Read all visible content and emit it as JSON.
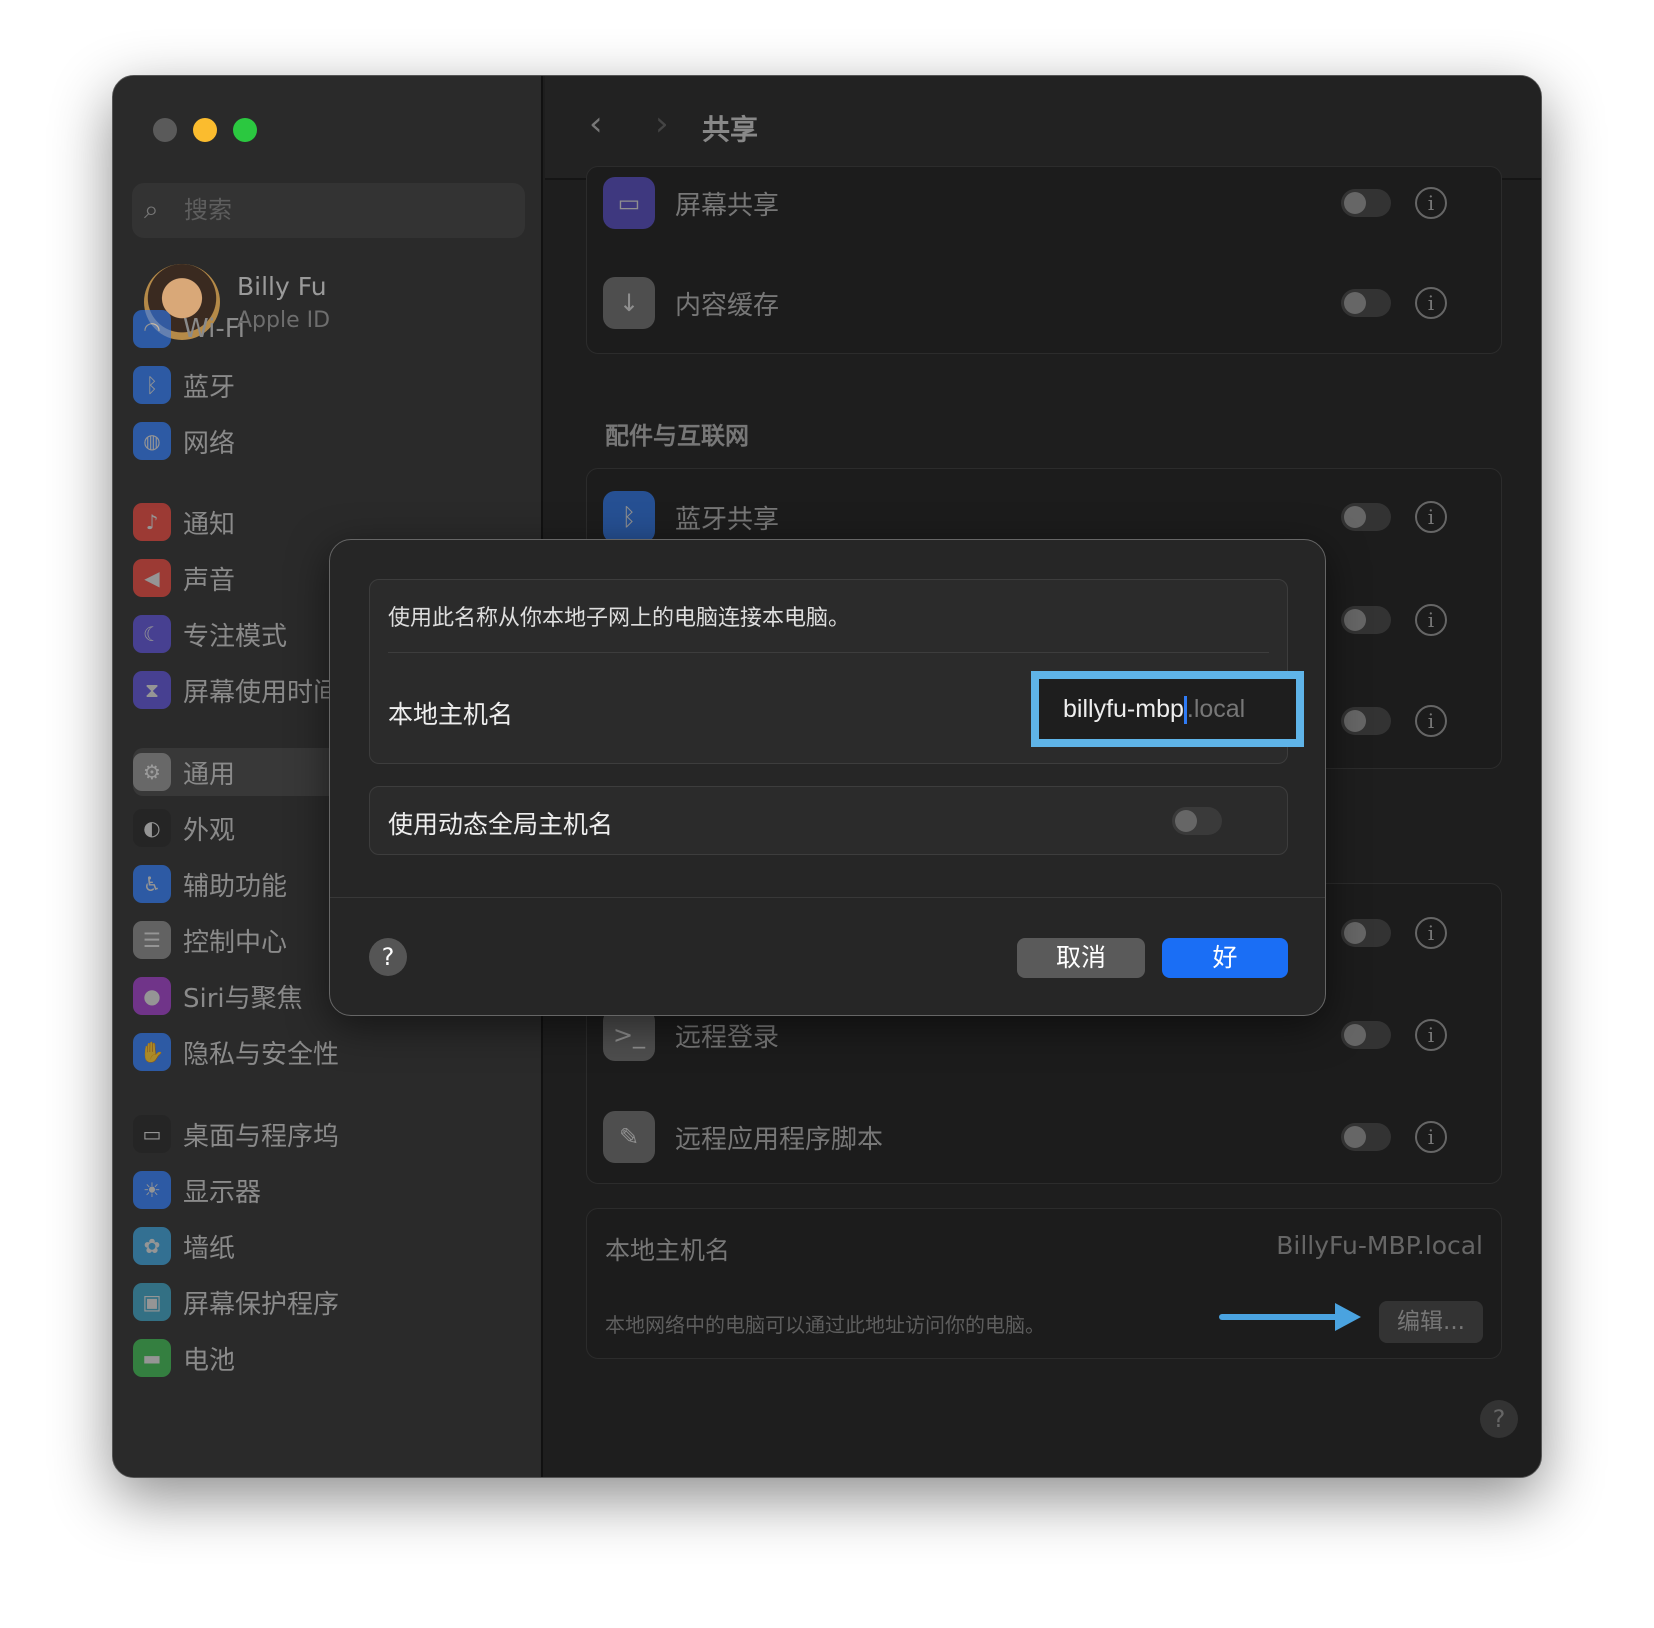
{
  "window": {
    "title": "共享"
  },
  "sidebar": {
    "search_placeholder": "搜索",
    "user": {
      "name": "Billy Fu",
      "subtitle": "Apple ID"
    },
    "items": [
      {
        "label": "Wi-Fi",
        "icon": "wifi-icon",
        "color": "#2f7bf5"
      },
      {
        "label": "蓝牙",
        "icon": "bluetooth-icon",
        "color": "#2f7bf5"
      },
      {
        "label": "网络",
        "icon": "globe-icon",
        "color": "#2f7bf5"
      },
      {
        "label": "通知",
        "icon": "bell-icon",
        "color": "#e8453c"
      },
      {
        "label": "声音",
        "icon": "speaker-icon",
        "color": "#e8453c"
      },
      {
        "label": "专注模式",
        "icon": "moon-icon",
        "color": "#5b4fd6"
      },
      {
        "label": "屏幕使用时间",
        "icon": "hourglass-icon",
        "color": "#5b4fd6"
      },
      {
        "label": "通用",
        "icon": "gear-icon",
        "color": "#888888",
        "selected": true
      },
      {
        "label": "外观",
        "icon": "appearance-icon",
        "color": "#222222"
      },
      {
        "label": "辅助功能",
        "icon": "accessibility-icon",
        "color": "#2f7bf5"
      },
      {
        "label": "控制中心",
        "icon": "control-center-icon",
        "color": "#888888"
      },
      {
        "label": "Siri与聚焦",
        "icon": "siri-icon",
        "color": "#a03cc8"
      },
      {
        "label": "隐私与安全性",
        "icon": "hand-icon",
        "color": "#2f7bf5"
      },
      {
        "label": "桌面与程序坞",
        "icon": "dock-icon",
        "color": "#222222"
      },
      {
        "label": "显示器",
        "icon": "sun-icon",
        "color": "#2f7bf5"
      },
      {
        "label": "墙纸",
        "icon": "flower-icon",
        "color": "#3aa0d8"
      },
      {
        "label": "屏幕保护程序",
        "icon": "screensaver-icon",
        "color": "#3aa0c0"
      },
      {
        "label": "电池",
        "icon": "battery-icon",
        "color": "#3cb850"
      }
    ]
  },
  "main": {
    "rows_top": [
      {
        "label": "屏幕共享",
        "icon": "screen-sharing-icon",
        "color": "#5a4fd0",
        "on": false
      },
      {
        "label": "内容缓存",
        "icon": "content-cache-icon",
        "color": "#777777",
        "on": false
      }
    ],
    "section2_title": "配件与互联网",
    "rows_mid": [
      {
        "label": "蓝牙共享",
        "icon": "bluetooth-icon",
        "color": "#2f7bf5",
        "on": false
      }
    ],
    "rows_bottom": [
      {
        "label": "远程登录",
        "icon": "terminal-icon",
        "color": "#777777",
        "on": false
      },
      {
        "label": "远程应用程序脚本",
        "icon": "script-icon",
        "color": "#777777",
        "on": false
      }
    ],
    "hostname": {
      "label": "本地主机名",
      "value": "BillyFu-MBP.local",
      "description": "本地网络中的电脑可以通过此地址访问你的电脑。",
      "edit_label": "编辑..."
    },
    "help": "?"
  },
  "dialog": {
    "description": "使用此名称从你本地子网上的电脑连接本电脑。",
    "hostname_label": "本地主机名",
    "hostname_value": "billyfu-mbp",
    "hostname_suffix": ".local",
    "dynamic_label": "使用动态全局主机名",
    "dynamic_on": false,
    "help": "?",
    "cancel": "取消",
    "ok": "好"
  },
  "colors": {
    "accent": "#1a6ef5",
    "focus_ring": "#5fb4e8",
    "annotation_arrow": "#4aa3e0"
  }
}
